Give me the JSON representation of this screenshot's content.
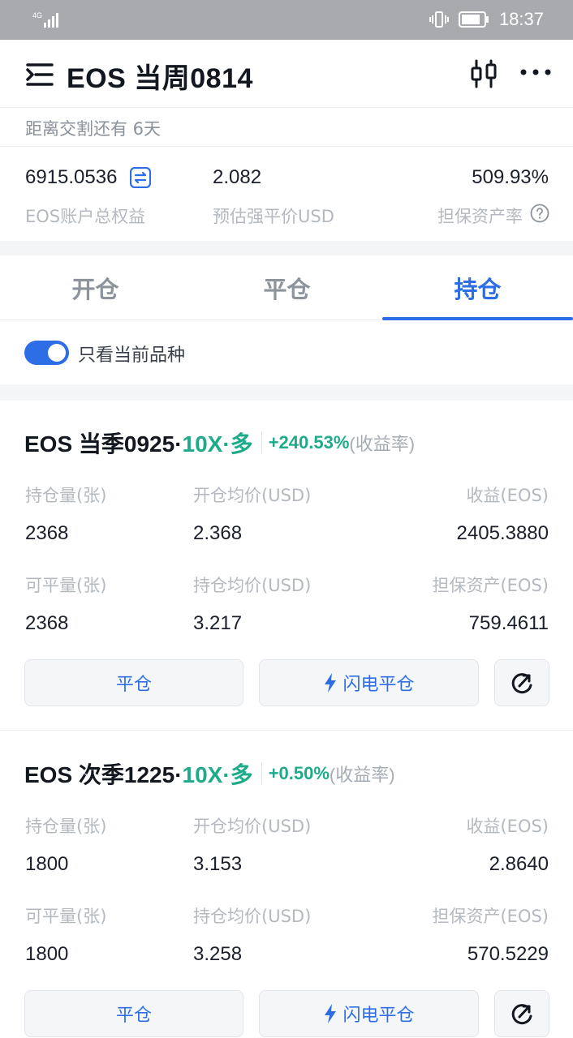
{
  "status_bar": {
    "network": "4G",
    "time": "18:37",
    "icons": [
      "signal-icon",
      "vibrate-icon",
      "battery-icon"
    ]
  },
  "header": {
    "title": "EOS 当周0814",
    "icons": [
      "menu-icon",
      "candlestick-icon",
      "more-icon"
    ]
  },
  "delivery_text": "距离交割还有 6天",
  "account": {
    "equity_value": "6915.0536",
    "equity_label": "EOS账户总权益",
    "liq_value": "2.082",
    "liq_label": "预估强平价USD",
    "ratio_value": "509.93%",
    "ratio_label": "担保资产率"
  },
  "tabs": [
    {
      "label": "开仓",
      "active": false
    },
    {
      "label": "平仓",
      "active": false
    },
    {
      "label": "持仓",
      "active": true
    }
  ],
  "filter": {
    "label": "只看当前品种",
    "enabled": true
  },
  "labels": {
    "hold_qty": "持仓量(张)",
    "open_avg": "开仓均价(USD)",
    "pnl": "收益(EOS)",
    "closable_qty": "可平量(张)",
    "hold_avg": "持仓均价(USD)",
    "margin": "担保资产(EOS)",
    "close_button": "平仓",
    "flash_close_button": "闪电平仓",
    "yield_label": "(收益率)"
  },
  "positions": [
    {
      "name": "EOS 当季0925·",
      "leverage": "10X·多",
      "yield": "+240.53%",
      "hold_qty": "2368",
      "open_avg": "2.368",
      "pnl": "2405.3880",
      "closable_qty": "2368",
      "hold_avg": "3.217",
      "margin": "759.4611"
    },
    {
      "name": "EOS 次季1225·",
      "leverage": "10X·多",
      "yield": "+0.50%",
      "hold_qty": "1800",
      "open_avg": "3.153",
      "pnl": "2.8640",
      "closable_qty": "1800",
      "hold_avg": "3.258",
      "margin": "570.5229"
    }
  ],
  "colors": {
    "accent": "#2d6ee6",
    "long_green": "#1dab8a",
    "status_bar": "#a9aaae"
  }
}
